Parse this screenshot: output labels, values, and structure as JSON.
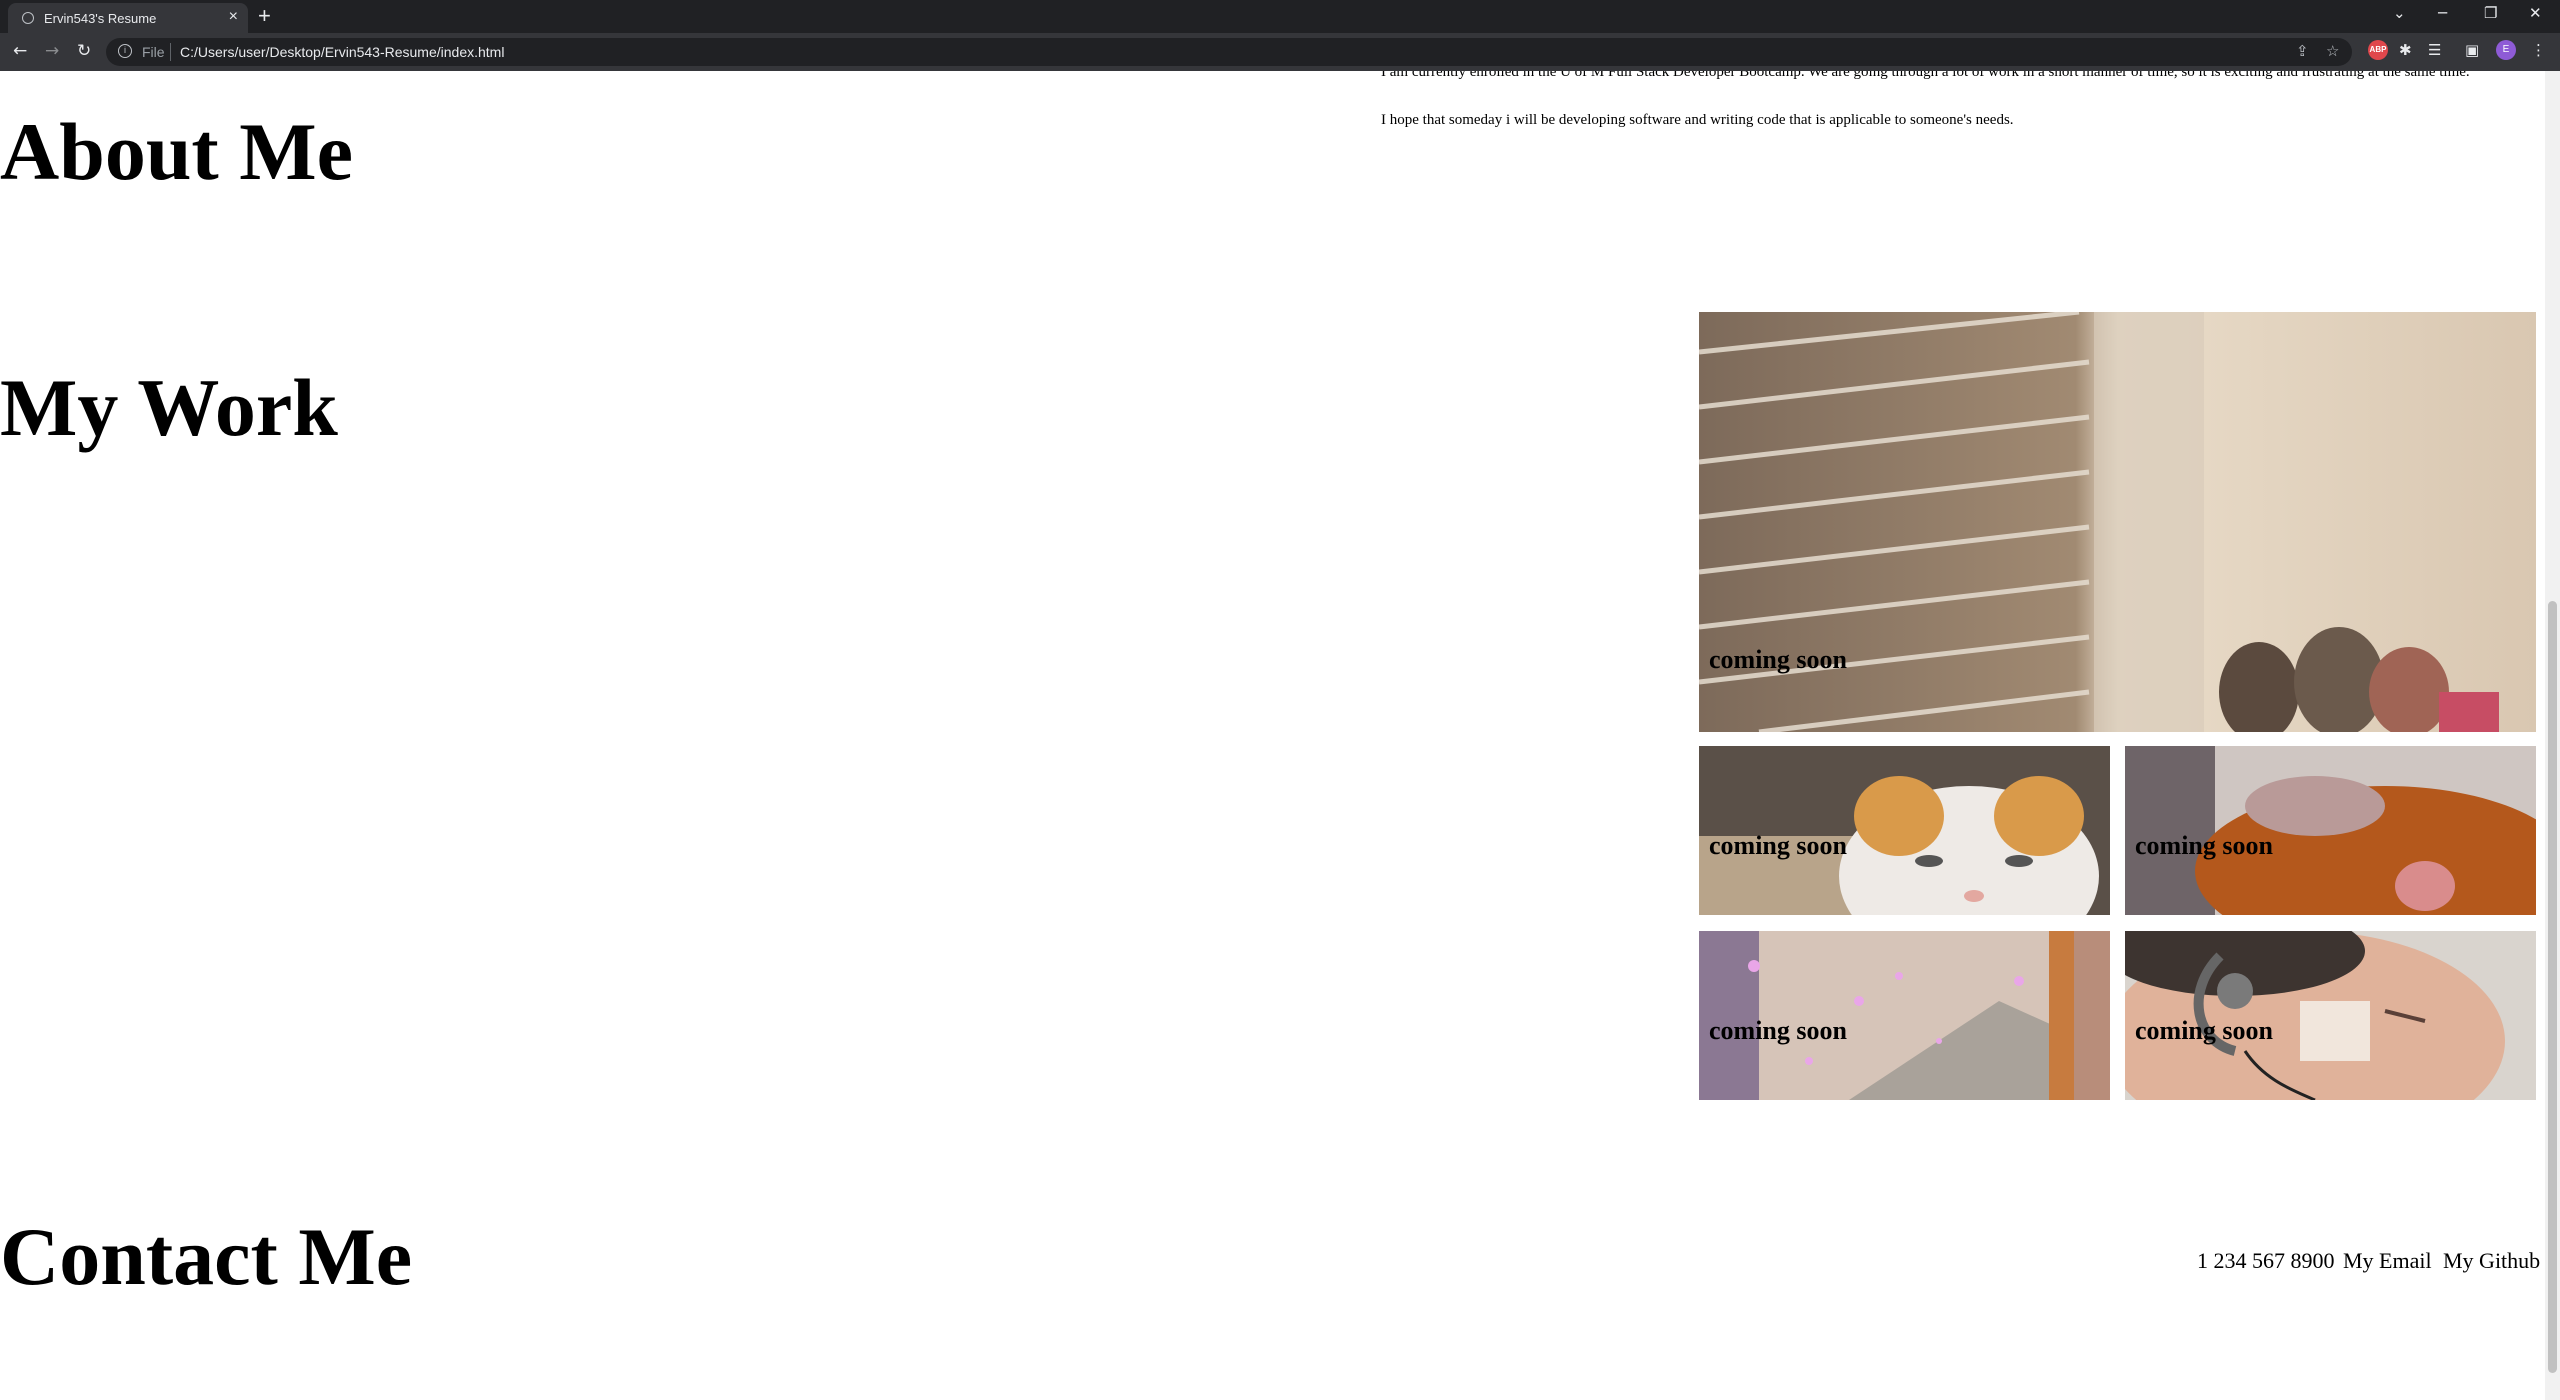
{
  "browser": {
    "tab_title": "Ervin543's Resume",
    "tab_close": "×",
    "new_tab": "+",
    "scheme": "File",
    "url": "C:/Users/user/Desktop/Ervin543-Resume/index.html",
    "abp_label": "ABP",
    "profile_initial": "E"
  },
  "about": {
    "heading": "About Me",
    "paragraph_1": "I am currently enrolled in the U of M Full Stack Developer Bootcamp. We are going through a lot of work in a short manner of time, so it is exciting and frustrating at the same time.",
    "paragraph_2": "I hope that someday i will be developing software and writing code that is applicable to someone's needs."
  },
  "work": {
    "heading": "My Work",
    "projects": [
      {
        "caption": "coming soon",
        "image": "blinds-and-cat-photo"
      },
      {
        "caption": "coming soon",
        "image": "cat-closeup-photo"
      },
      {
        "caption": "coming soon",
        "image": "dog-photo"
      },
      {
        "caption": "coming soon",
        "image": "sparkle-scene-photo"
      },
      {
        "caption": "coming soon",
        "image": "man-with-headset-photo"
      }
    ]
  },
  "contact": {
    "heading": "Contact Me",
    "phone": "1 234 567 8900",
    "email_label": "My Email",
    "github_label": "My Github"
  },
  "colors": {
    "chrome_dark": "#202124",
    "chrome_tab": "#35363a",
    "abp_red": "#e0474c",
    "profile_purple": "#8e5bd6"
  }
}
